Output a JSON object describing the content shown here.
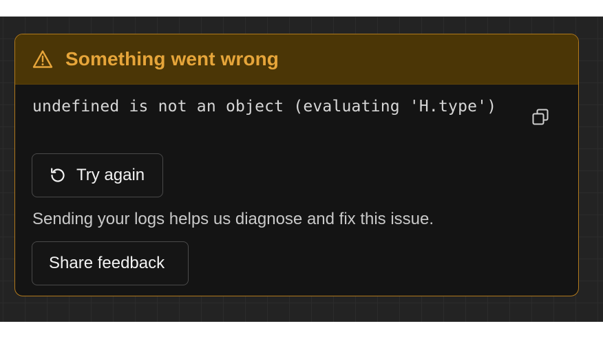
{
  "error": {
    "title": "Something went wrong",
    "message": "undefined is not an object (evaluating 'H.type')",
    "hint": "Sending your logs helps us diagnose and fix this issue."
  },
  "actions": {
    "try_again_label": "Try again",
    "share_feedback_label": "Share feedback"
  },
  "icons": {
    "header": "warning-triangle-icon",
    "copy": "copy-icon",
    "retry": "rotate-ccw-icon"
  },
  "colors": {
    "accent": "#e6a53a",
    "header_bg": "#4b3606",
    "card_border": "#b27a1c",
    "card_bg": "#141414",
    "canvas_bg": "#232323"
  }
}
